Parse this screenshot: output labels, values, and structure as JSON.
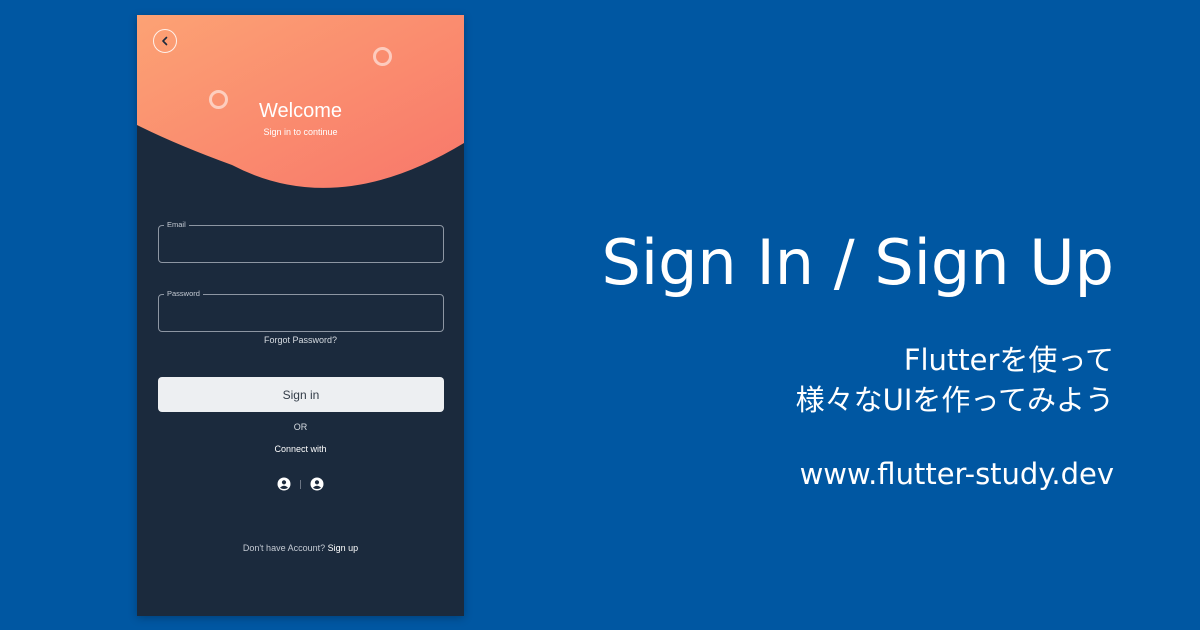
{
  "phone": {
    "header": {
      "title": "Welcome",
      "subtitle": "Sign in to continue",
      "gradient_start": "#fc9a71",
      "gradient_end": "#f97b69",
      "back_icon": "chevron-left-icon"
    },
    "form": {
      "email_label": "Email",
      "email_value": "",
      "password_label": "Password",
      "password_value": "",
      "forgot_label": "Forgot Password?",
      "signin_label": "Sign in"
    },
    "social": {
      "or_label": "OR",
      "connect_label": "Connect with",
      "icons": [
        "account-circle-icon",
        "account-circle-icon"
      ]
    },
    "signup": {
      "prompt": "Don't have Account?",
      "link": "Sign up"
    },
    "background_color": "#1b2a3d"
  },
  "promo": {
    "title": "Sign In / Sign Up",
    "tagline_line1": "Flutterを使って",
    "tagline_line2": "様々なUIを作ってみよう",
    "url": "www.flutter-study.dev",
    "background_color": "#0057a2"
  }
}
